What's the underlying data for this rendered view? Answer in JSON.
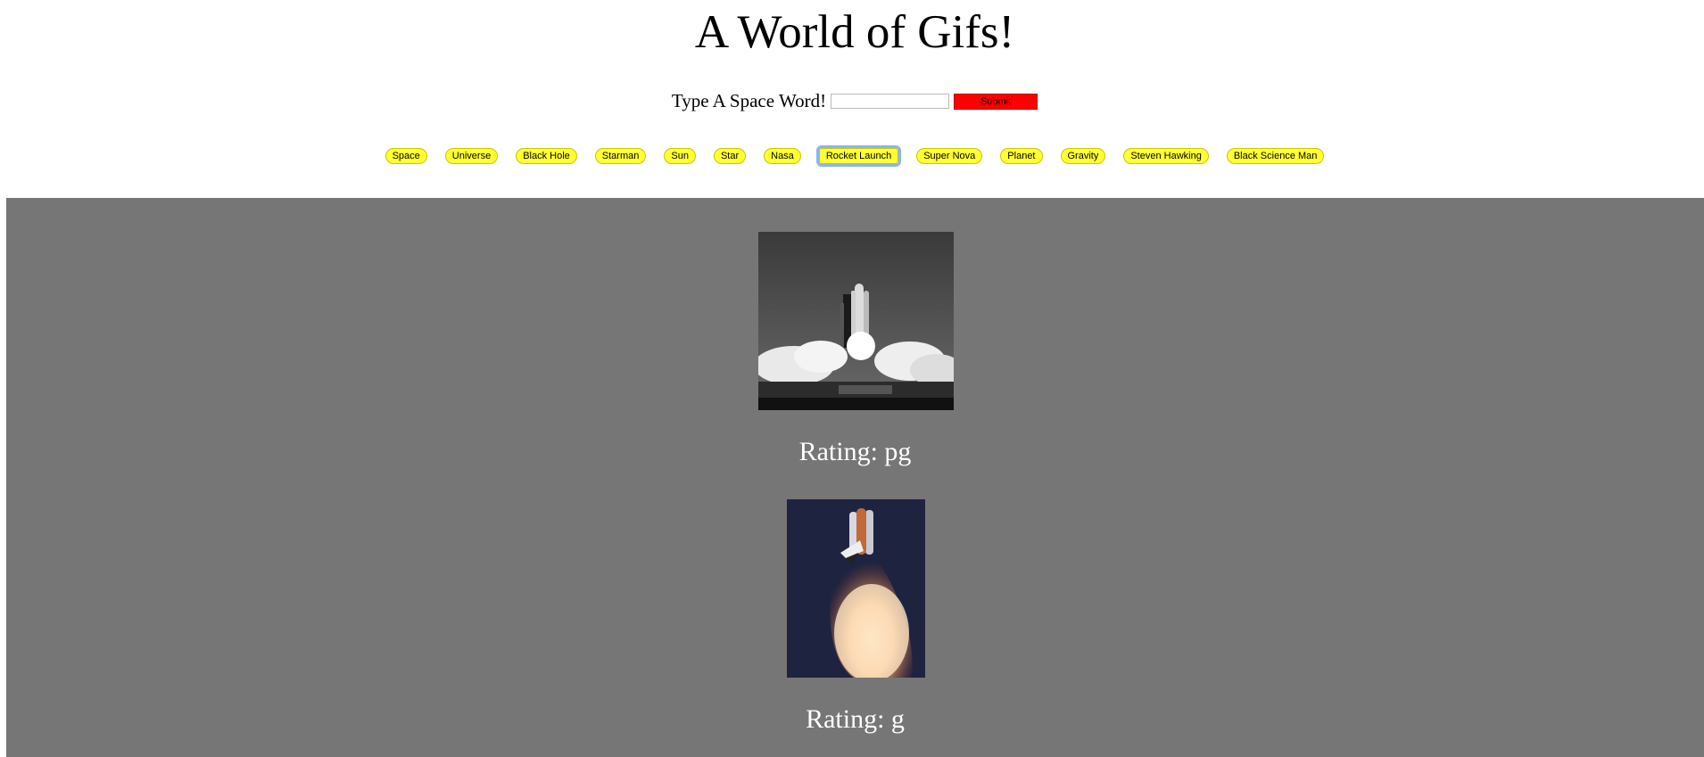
{
  "header": {
    "title": "A World of Gifs!"
  },
  "search": {
    "label": "Type A Space Word!",
    "value": "",
    "placeholder": "",
    "submit_label": "Submit"
  },
  "topics": [
    "Space",
    "Universe",
    "Black Hole",
    "Starman",
    "Sun",
    "Star",
    "Nasa",
    "Rocket Launch",
    "Super Nova",
    "Planet",
    "Gravity",
    "Steven Hawking",
    "Black Science Man"
  ],
  "active_topic": "Rocket Launch",
  "results": [
    {
      "image": "rocket-launch-grayscale-gif",
      "rating_text": "Rating: pg"
    },
    {
      "image": "rocket-launch-color-gif",
      "rating_text": "Rating: g"
    }
  ],
  "colors": {
    "results_bg": "#767676",
    "submit_bg": "#ff0000",
    "topic_bg": "#ffff33",
    "focus_ring": "#8ab4f8"
  }
}
